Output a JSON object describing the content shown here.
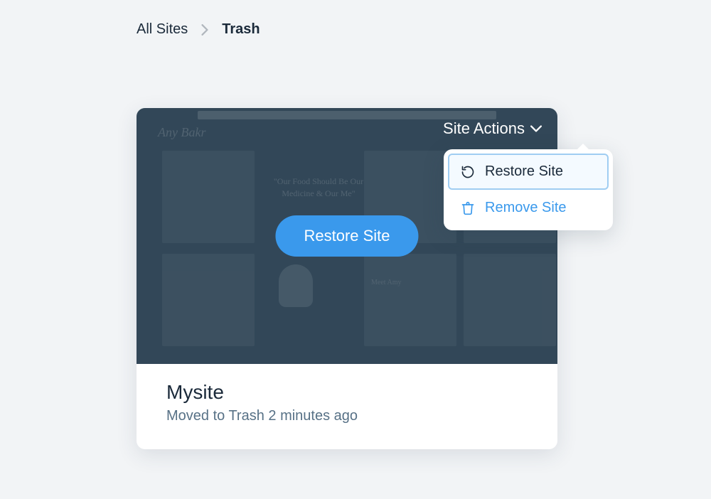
{
  "breadcrumb": {
    "root": "All Sites",
    "current": "Trash"
  },
  "site_card": {
    "actions_trigger": "Site Actions",
    "restore_button": "Restore Site",
    "name": "Mysite",
    "status": "Moved to Trash 2 minutes ago"
  },
  "dropdown": {
    "restore": "Restore Site",
    "remove": "Remove Site"
  }
}
